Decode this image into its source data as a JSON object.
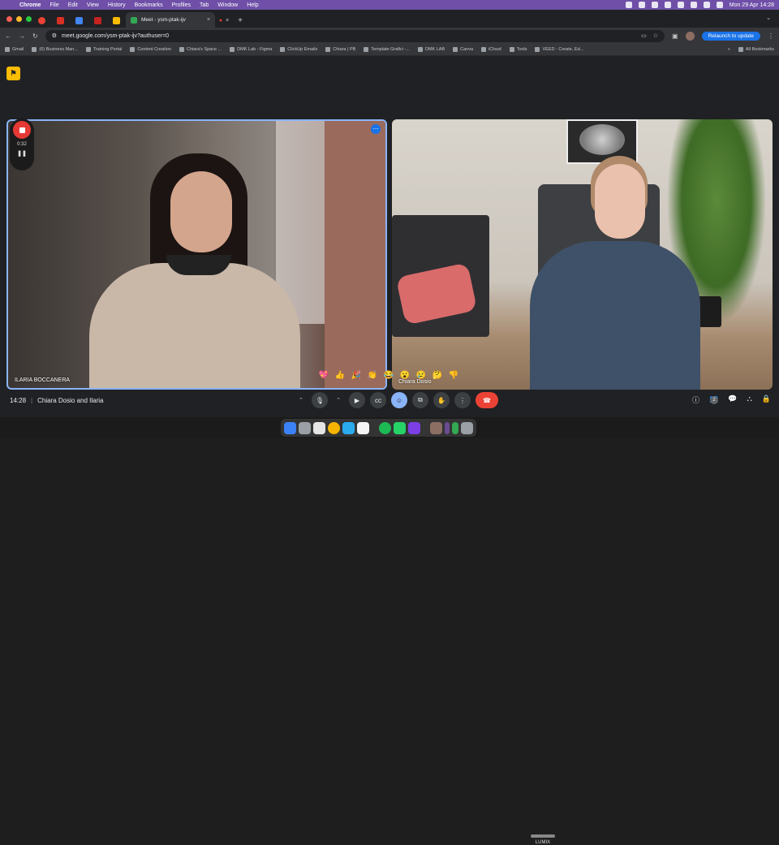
{
  "menubar": {
    "app": "Chrome",
    "menus": [
      "File",
      "Edit",
      "View",
      "History",
      "Bookmarks",
      "Profiles",
      "Tab",
      "Window",
      "Help"
    ],
    "clock": "Mon 29 Apr  14:28"
  },
  "tabs": {
    "active_title": "Meet - ysm-ptak-ijv"
  },
  "address_bar": {
    "url": "meet.google.com/ysm-ptak-ijv?authuser=0",
    "relaunch_label": "Relaunch to update"
  },
  "bookmarks": {
    "items": [
      "Gmail",
      "(6) Business Man...",
      "Training Portal",
      "Content Creation",
      "Chiara's Space ...",
      "DMK Lab - Figma",
      "ClickUp Emails",
      "Chiara | PB",
      "Template Grafici -...",
      "DMK LAB",
      "Canva",
      "iCloud",
      "Tools",
      "VEED - Create, Ed..."
    ],
    "more": "»",
    "all_bookmarks": "All Bookmarks"
  },
  "participants": [
    {
      "name": "ILARIA BOCCANERA"
    },
    {
      "name": "Chiara Dosio"
    }
  ],
  "recorder": {
    "elapsed": "0:32"
  },
  "reactions": [
    "💖",
    "👍",
    "🎉",
    "👏",
    "😂",
    "😮",
    "😢",
    "🤔",
    "👎"
  ],
  "meeting": {
    "time": "14:28",
    "separator": "|",
    "title": "Chiara Dosio and Ilaria"
  },
  "controls": {
    "people_count": "2"
  },
  "dock": {
    "label": "LUMIX"
  },
  "colors": {
    "menubar": "#6f4fa8",
    "meet_background": "#202124",
    "active_speaker_border": "#8ab4f8",
    "end_call": "#ea4335",
    "relaunch": "#1a73e8"
  }
}
